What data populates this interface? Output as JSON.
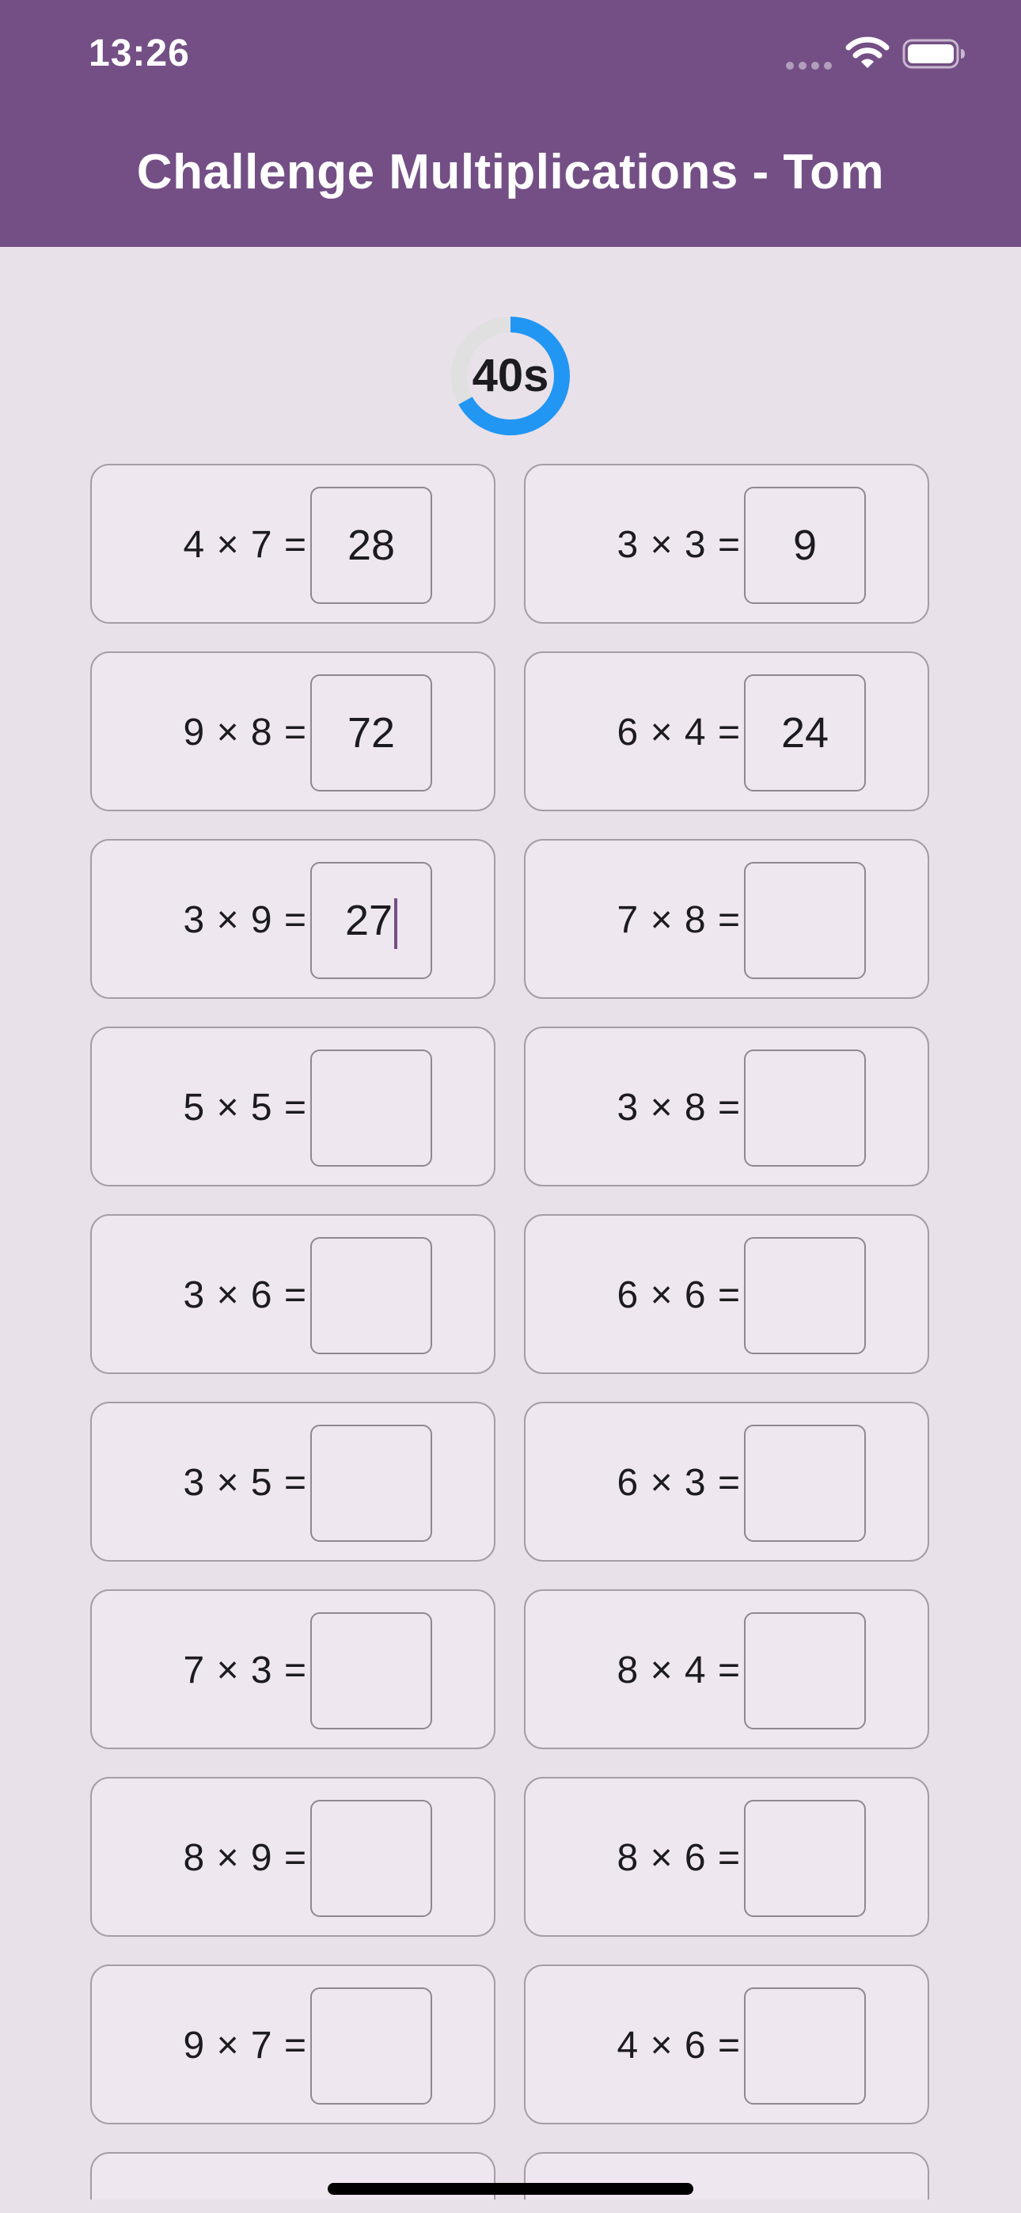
{
  "status_bar": {
    "time": "13:26",
    "icons": [
      "signal-icon",
      "wifi-icon",
      "battery-icon"
    ]
  },
  "header": {
    "title": "Challenge Multiplications - Tom",
    "background_color": "#744F85"
  },
  "timer": {
    "label": "40s",
    "seconds_remaining": 40,
    "remaining_fraction": 0.67,
    "progress_color": "#2196F3",
    "track_color": "#E0E0E0"
  },
  "problems": [
    {
      "expression": "4 × 7 =",
      "answer": "28"
    },
    {
      "expression": "3 × 3 =",
      "answer": "9"
    },
    {
      "expression": "9 × 8 =",
      "answer": "72"
    },
    {
      "expression": "6 × 4 =",
      "answer": "24"
    },
    {
      "expression": "3 × 9 =",
      "answer": "27",
      "focused": true
    },
    {
      "expression": "7 × 8 =",
      "answer": ""
    },
    {
      "expression": "5 × 5 =",
      "answer": ""
    },
    {
      "expression": "3 × 8 =",
      "answer": ""
    },
    {
      "expression": "3 × 6 =",
      "answer": ""
    },
    {
      "expression": "6 × 6 =",
      "answer": ""
    },
    {
      "expression": "3 × 5 =",
      "answer": ""
    },
    {
      "expression": "6 × 3 =",
      "answer": ""
    },
    {
      "expression": "7 × 3 =",
      "answer": ""
    },
    {
      "expression": "8 × 4 =",
      "answer": ""
    },
    {
      "expression": "8 × 9 =",
      "answer": ""
    },
    {
      "expression": "8 × 6 =",
      "answer": ""
    },
    {
      "expression": "9 × 7 =",
      "answer": ""
    },
    {
      "expression": "4 × 6 =",
      "answer": ""
    }
  ]
}
